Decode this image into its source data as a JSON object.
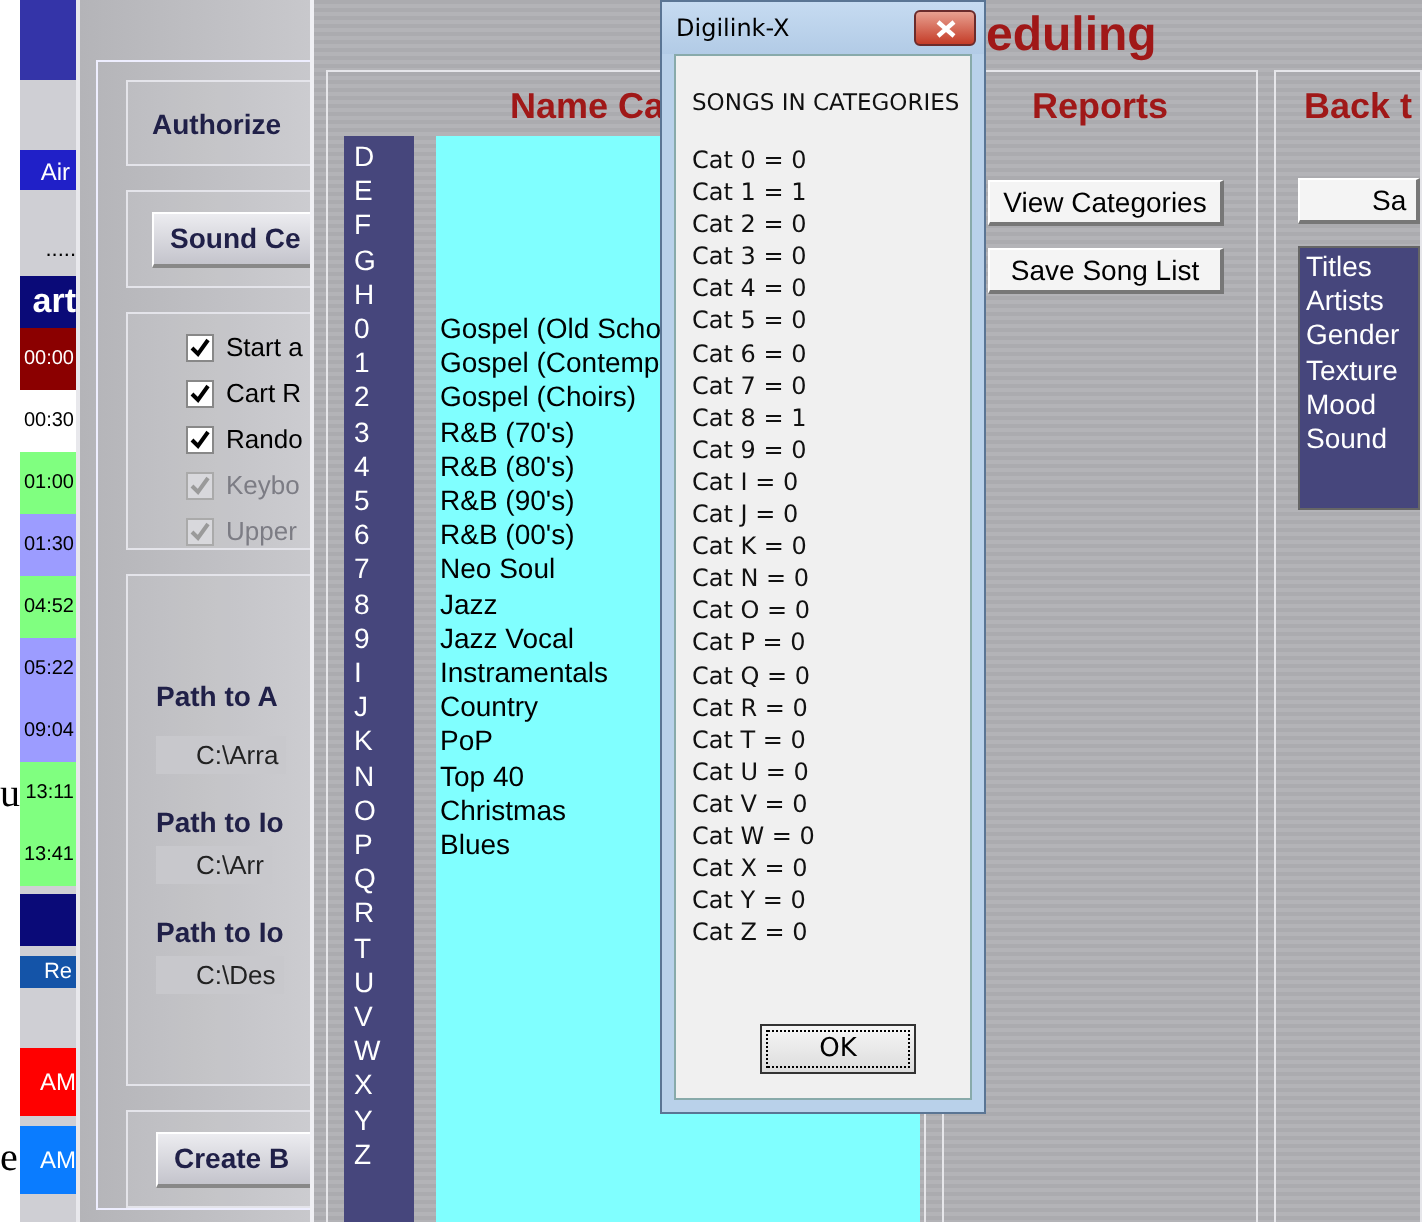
{
  "edge_text": [
    "u",
    "e"
  ],
  "schedule_strip": {
    "air_button": "Air",
    "separator": ".....",
    "header": "art",
    "rows": [
      {
        "time": "00:00",
        "color": "#8b0000"
      },
      {
        "time": "00:30",
        "color": "#ffffff"
      },
      {
        "time": "01:00",
        "color": "#80ff80"
      },
      {
        "time": "01:30",
        "color": "#9c9cff"
      },
      {
        "time": "04:52",
        "color": "#80ff80"
      },
      {
        "time": "05:22",
        "color": "#9c9cff"
      },
      {
        "time": "09:04",
        "color": "#9c9cff"
      },
      {
        "time": "13:11",
        "color": "#80ff80"
      },
      {
        "time": "13:41",
        "color": "#80ff80"
      }
    ],
    "re_button": "Re",
    "am_items": [
      {
        "label": "AM",
        "color": "#ff0000"
      },
      {
        "label": "AM",
        "color": "#0a7cff"
      }
    ]
  },
  "settings_window": {
    "authorize_label": "Authorize",
    "sound_button": "Sound Ce",
    "options": [
      {
        "label": "Start a",
        "checked": true,
        "disabled": false
      },
      {
        "label": "Cart R",
        "checked": true,
        "disabled": false
      },
      {
        "label": "Rando",
        "checked": true,
        "disabled": false
      },
      {
        "label": "Keybo",
        "checked": true,
        "disabled": true
      },
      {
        "label": "Upper",
        "checked": true,
        "disabled": true
      }
    ],
    "paths": [
      {
        "label": "Path to A",
        "value": "C:\\Arra"
      },
      {
        "label": "Path to Io",
        "value": "C:\\Arr"
      },
      {
        "label": "Path to Io",
        "value": "C:\\Des"
      }
    ],
    "create_button": "Create B"
  },
  "main_window": {
    "title": "eduling",
    "categories": {
      "title": "Name Ca",
      "codes": [
        "D",
        "E",
        "F",
        "G",
        "H",
        "0",
        "1",
        "2",
        "3",
        "4",
        "5",
        "6",
        "7",
        "8",
        "9",
        "I",
        "J",
        "K",
        "N",
        "O",
        "P",
        "Q",
        "R",
        "T",
        "U",
        "V",
        "W",
        "X",
        "Y",
        "Z"
      ],
      "names": [
        "Gospel (Old Scho",
        "Gospel (Contemp",
        "Gospel (Choirs)",
        "R&B (70's)",
        "R&B (80's)",
        "R&B (90's)",
        "R&B (00's)",
        "Neo Soul",
        "Jazz",
        "Jazz Vocal",
        "Instramentals",
        "Country",
        "PoP",
        "Top 40",
        "Christmas",
        "Blues"
      ]
    },
    "reports": {
      "title": "Reports",
      "buttons": [
        "View Categories",
        "Save Song List"
      ]
    },
    "back": {
      "title": "Back t",
      "button": "Sa",
      "fields": [
        "Titles",
        "Artists",
        "Gender",
        "Texture",
        "Mood",
        "Sound"
      ]
    }
  },
  "dialog": {
    "title": "Digilink-X",
    "heading": "SONGS IN CATEGORIES",
    "lines": [
      "Cat 0 = 0",
      "Cat 1 = 1",
      "Cat 2 = 0",
      "Cat 3 = 0",
      "Cat 4 = 0",
      "Cat 5 = 0",
      "Cat 6 = 0",
      "Cat 7 = 0",
      "Cat 8 = 1",
      "Cat 9 = 0",
      "Cat I = 0",
      "Cat J = 0",
      "Cat K = 0",
      "Cat N = 0",
      "Cat O = 0",
      "Cat P = 0",
      "Cat Q = 0",
      "Cat R = 0",
      "Cat T = 0",
      "Cat U = 0",
      "Cat V = 0",
      "Cat W = 0",
      "Cat X = 0",
      "Cat Y = 0",
      "Cat Z = 0"
    ],
    "ok_button": "OK"
  }
}
